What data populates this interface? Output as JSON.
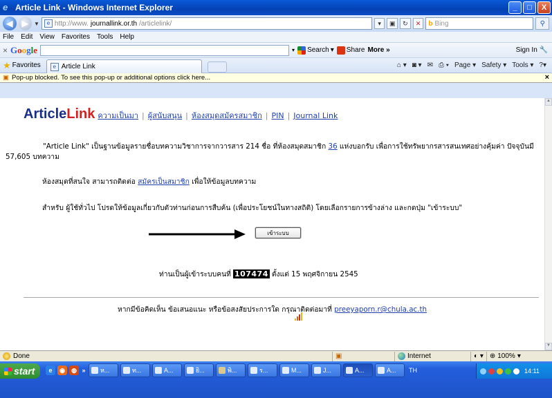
{
  "window": {
    "title": "Article Link - Windows Internet Explorer",
    "controls": {
      "minimize": "_",
      "maximize": "□",
      "close": "X"
    }
  },
  "address_bar": {
    "url_prefix": "http://www.",
    "url_domain": "journallink.or.th",
    "url_path": "/articlelink/",
    "search_placeholder": "Bing"
  },
  "menu": [
    "File",
    "Edit",
    "View",
    "Favorites",
    "Tools",
    "Help"
  ],
  "google_toolbar": {
    "close": "×",
    "logo": [
      "G",
      "o",
      "o",
      "g",
      "l",
      "e"
    ],
    "search_label": "Search",
    "share_label": "Share",
    "more_label": "More »",
    "signin_label": "Sign In"
  },
  "favorites_bar": {
    "favorites_label": "Favorites",
    "tab_label": "Article Link",
    "commands": [
      "Page ▾",
      "Safety ▾",
      "Tools ▾"
    ]
  },
  "info_bar": {
    "message": "Pop-up blocked. To see this pop-up or additional options click here..."
  },
  "page": {
    "brand_part1": "Article",
    "brand_part2": "Link",
    "nav": [
      "ความเป็นมา",
      "ผู้สนับสนุน",
      "ห้องสมุดสมัครสมาชิก",
      "PIN",
      "Journal Link"
    ],
    "para1_a": "\"Article Link\" เป็นฐานข้อมูลรายชื่อบทความวิชาการจากวารสาร 214 ชื่อ ที่ห้องสมุดสมาชิก",
    "para1_link": "36",
    "para1_b": "แห่งบอกรับ   เพื่อการใช้ทรัพยากรสารสนเทศอย่างคุ้มค่า ปัจจุบันมี 57,605 บทความ",
    "para2_a": "ห้องสมุดที่สนใจ สามารถติดต่อ",
    "para2_link": "สมัครเป็นสมาชิก",
    "para2_b": "เพื่อให้ข้อมูลบทความ",
    "para3": "สำหรับ ผู้ใช้ทั่วไป โปรดให้ข้อมูลเกี่ยวกับตัวท่านก่อนการสืบค้น (เพื่อประโยชน์ในทางสถิติ) โดยเลือกรายการข้างล่าง และกดปุ่ม \"เข้าระบบ\"",
    "enter_button": "เข้าระบบ",
    "counter_a": "ท่านเป็นผู้เข้าระบบคนที่",
    "counter_value": "107474",
    "counter_b": "ตั้งแต่ 15 พฤศจิกายน 2545",
    "footer_a": "หากมีข้อคิดเห็น ข้อเสนอแนะ หรือข้อสงสัยประการใด กรุณาติดต่อมาที่",
    "footer_email": "preeyaporn.r@chula.ac.th"
  },
  "status_bar": {
    "status": "Done",
    "zone": "Internet",
    "zoom": "100%"
  },
  "taskbar": {
    "start_label": "start",
    "buttons": [
      "ห...",
      "ท...",
      "A...",
      "ยิ...",
      "พิ...",
      "ร...",
      "M...",
      "J...",
      "A...",
      "A..."
    ],
    "language": "TH",
    "clock": "14:11"
  },
  "colors": {
    "brand_dark": "#1a2f86",
    "brand_red": "#d21f1f",
    "link": "#2040b0",
    "titlebar": "#0a5ad8",
    "taskbar": "#245edb"
  }
}
